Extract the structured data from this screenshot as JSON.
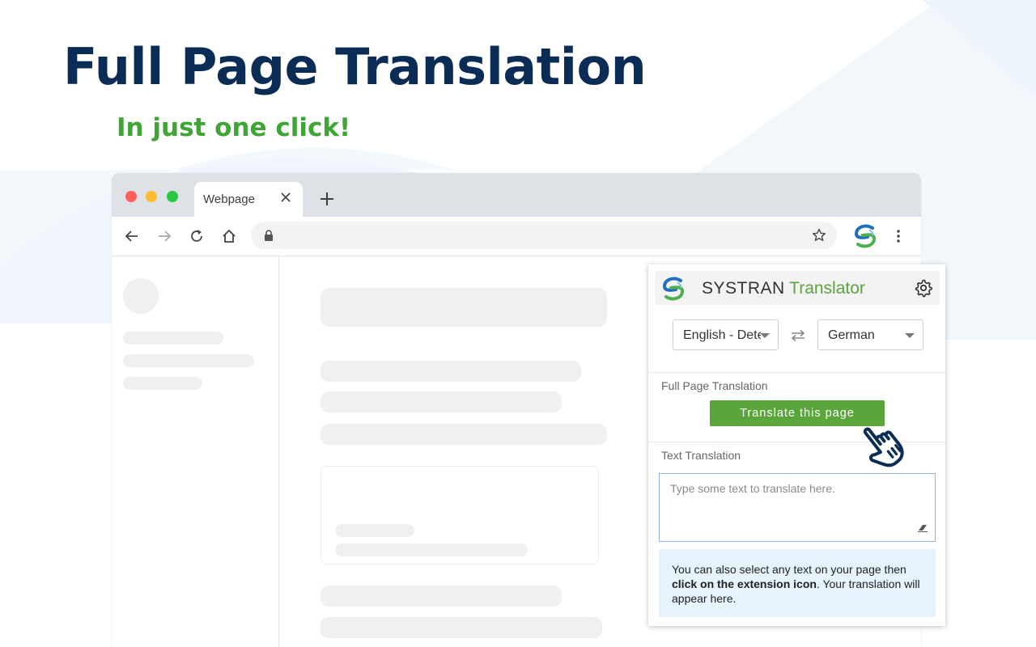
{
  "headline": "Full Page Translation",
  "subline": "In just one click!",
  "browser": {
    "tab_title": "Webpage"
  },
  "extension": {
    "brand_systran": "SYSTRAN",
    "brand_translator": "Translator",
    "source_language": "English - Detect",
    "target_language": "German",
    "full_page_label": "Full Page Translation",
    "translate_button": "Translate this page",
    "text_translation_label": "Text Translation",
    "text_placeholder": "Type some text to translate here.",
    "info_part1": "You can also select any text on your page then ",
    "info_bold": "click on the extension icon",
    "info_part2": ". Your translation will appear here."
  },
  "colors": {
    "headline": "#0b2d55",
    "accent_green": "#3fa535",
    "button_green": "#5aa63d",
    "info_bg": "#e6f3fc"
  },
  "icons": [
    "back-arrow-icon",
    "forward-arrow-icon",
    "reload-icon",
    "home-icon",
    "lock-icon",
    "star-icon",
    "systran-logo-icon",
    "kebab-menu-icon",
    "gear-icon",
    "swap-icon",
    "eraser-icon",
    "pointer-hand-icon",
    "close-icon",
    "plus-icon"
  ]
}
